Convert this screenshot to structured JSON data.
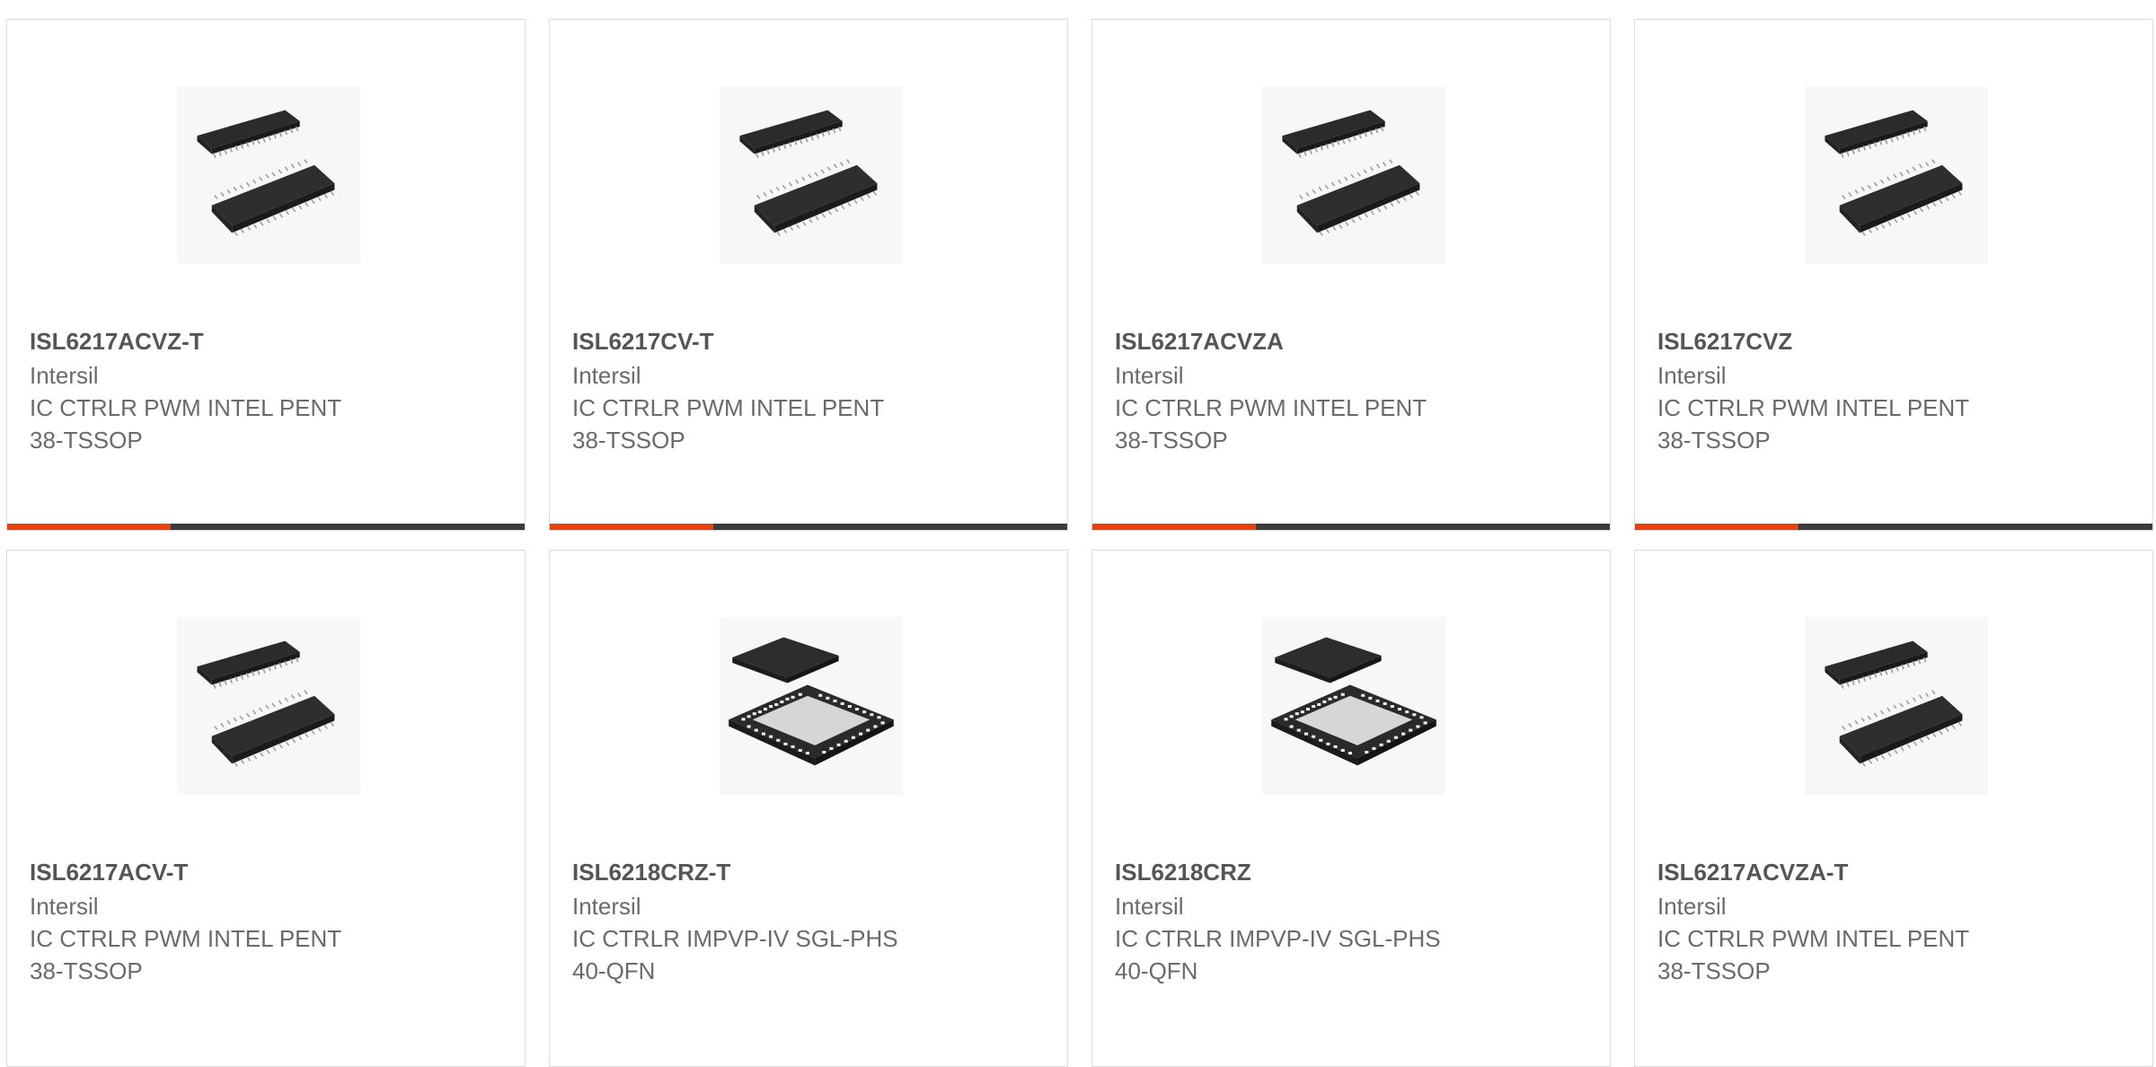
{
  "colors": {
    "accent": "#e8410f",
    "bar": "#3c3c3c",
    "border": "#dcdcdc",
    "title": "#555555",
    "text": "#6a6a6a"
  },
  "products": [
    {
      "part_number": "ISL6217ACVZ-T",
      "manufacturer": "Intersil",
      "description": "IC CTRLR PWM INTEL PENT",
      "package": "38-TSSOP",
      "image_icon": "tssop-chip-icon"
    },
    {
      "part_number": "ISL6217CV-T",
      "manufacturer": "Intersil",
      "description": "IC CTRLR PWM INTEL PENT",
      "package": "38-TSSOP",
      "image_icon": "tssop-chip-icon"
    },
    {
      "part_number": "ISL6217ACVZA",
      "manufacturer": "Intersil",
      "description": "IC CTRLR PWM INTEL PENT",
      "package": "38-TSSOP",
      "image_icon": "tssop-chip-icon"
    },
    {
      "part_number": "ISL6217CVZ",
      "manufacturer": "Intersil",
      "description": "IC CTRLR PWM INTEL PENT",
      "package": "38-TSSOP",
      "image_icon": "tssop-chip-icon"
    },
    {
      "part_number": "ISL6217ACV-T",
      "manufacturer": "Intersil",
      "description": "IC CTRLR PWM INTEL PENT",
      "package": "38-TSSOP",
      "image_icon": "tssop-chip-icon"
    },
    {
      "part_number": "ISL6218CRZ-T",
      "manufacturer": "Intersil",
      "description": "IC CTRLR IMPVP-IV SGL-PHS",
      "package": "40-QFN",
      "image_icon": "qfn-chip-icon"
    },
    {
      "part_number": "ISL6218CRZ",
      "manufacturer": "Intersil",
      "description": "IC CTRLR IMPVP-IV SGL-PHS",
      "package": "40-QFN",
      "image_icon": "qfn-chip-icon"
    },
    {
      "part_number": "ISL6217ACVZA-T",
      "manufacturer": "Intersil",
      "description": "IC CTRLR PWM INTEL PENT",
      "package": "38-TSSOP",
      "image_icon": "tssop-chip-icon"
    }
  ]
}
